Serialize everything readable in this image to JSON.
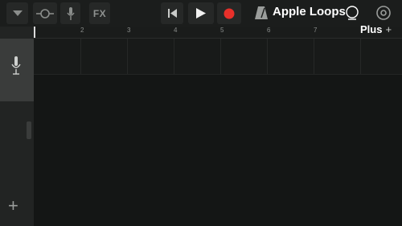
{
  "toolbar": {
    "fx_label": "FX",
    "loops_label": "Apple Loops",
    "plus_label": "Plus",
    "plus_sign": "+"
  },
  "ruler": {
    "bars": [
      "2",
      "3",
      "4",
      "5",
      "6",
      "7"
    ]
  },
  "track_header": {
    "add_track_label": "+"
  },
  "colors": {
    "record": "#e8302a",
    "accent_white": "#ffffff"
  }
}
